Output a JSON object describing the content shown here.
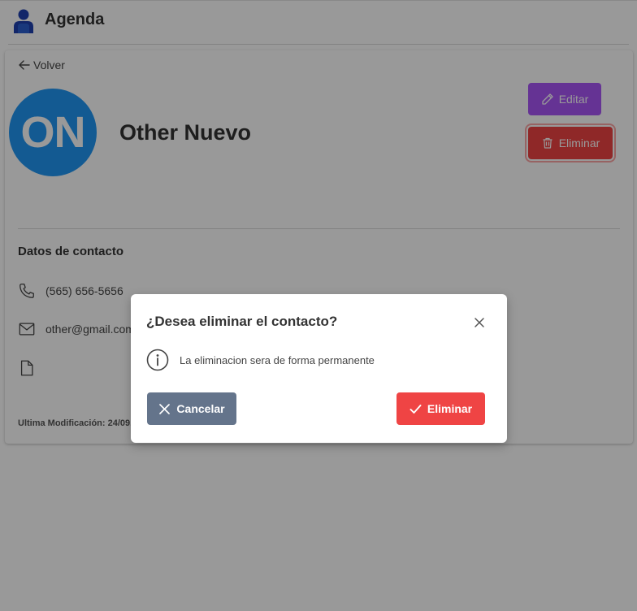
{
  "app": {
    "title": "Agenda",
    "logo_icon": "user-icon",
    "logo_color": "#1e40af"
  },
  "contact": {
    "back_label": "Volver",
    "initials": "ON",
    "name": "Other Nuevo",
    "avatar_color": "#2196f3",
    "edit_label": "Editar",
    "delete_label": "Eliminar",
    "section_title": "Datos de contacto",
    "phone": "(565) 656-5656",
    "email": "other@gmail.com",
    "file": "",
    "last_modified": "Ultima Modificación: 24/09,"
  },
  "dialog": {
    "title": "¿Desea eliminar el contacto?",
    "message": "La eliminacion sera de forma permanente",
    "cancel_label": "Cancelar",
    "confirm_label": "Eliminar"
  },
  "colors": {
    "edit_button": "#a855f7",
    "delete_button": "#ef4444",
    "cancel_button": "#64748b",
    "overlay": "rgba(0,0,0,0.4)"
  }
}
